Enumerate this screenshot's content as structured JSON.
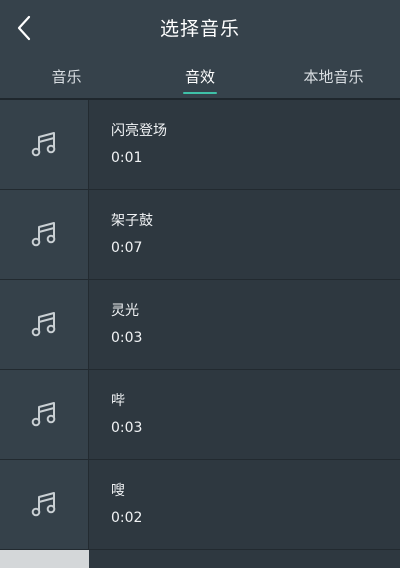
{
  "header": {
    "title": "选择音乐",
    "back_icon": "chevron-left-icon"
  },
  "tabs": [
    {
      "label": "音乐",
      "active": false
    },
    {
      "label": "音效",
      "active": true
    },
    {
      "label": "本地音乐",
      "active": false
    }
  ],
  "colors": {
    "accent": "#3fc1a8",
    "background": "#2c353d",
    "header": "#36424b"
  },
  "sounds": [
    {
      "name": "闪亮登场",
      "duration": "0:01",
      "icon": "music-note-icon"
    },
    {
      "name": "架子鼓",
      "duration": "0:07",
      "icon": "music-note-icon"
    },
    {
      "name": "灵光",
      "duration": "0:03",
      "icon": "music-note-icon"
    },
    {
      "name": "哔",
      "duration": "0:03",
      "icon": "music-note-icon"
    },
    {
      "name": "嗖",
      "duration": "0:02",
      "icon": "music-note-icon"
    }
  ]
}
